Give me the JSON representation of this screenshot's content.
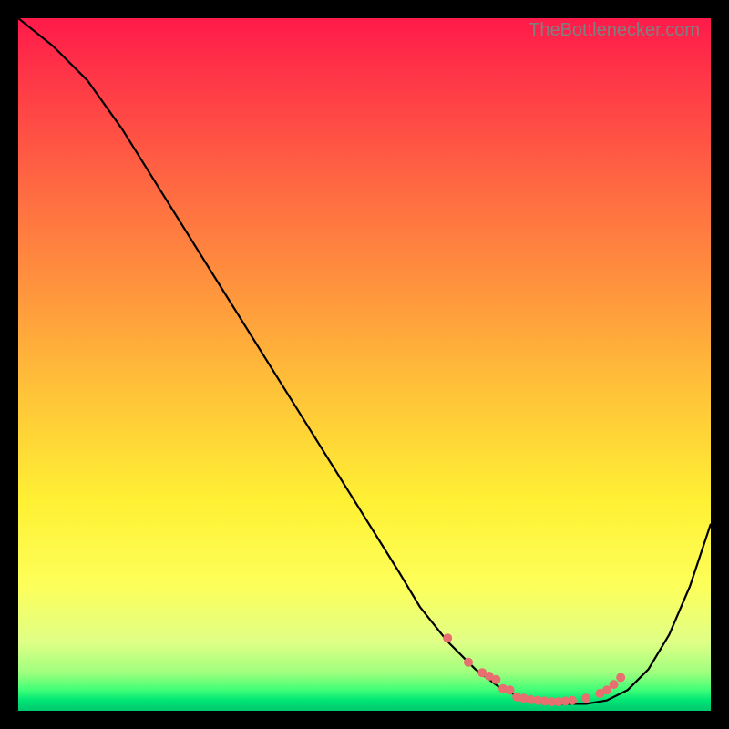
{
  "watermark": "TheBottlenecker.com",
  "chart_data": {
    "type": "line",
    "title": "",
    "xlabel": "",
    "ylabel": "",
    "xlim": [
      0,
      100
    ],
    "ylim": [
      0,
      100
    ],
    "series": [
      {
        "name": "curve",
        "color": "#000000",
        "x": [
          0,
          5,
          10,
          15,
          20,
          25,
          30,
          35,
          40,
          45,
          50,
          55,
          58,
          62,
          66,
          70,
          74,
          78,
          82,
          85,
          88,
          91,
          94,
          97,
          100
        ],
        "y": [
          100,
          96,
          91,
          84,
          76,
          68,
          60,
          52,
          44,
          36,
          28,
          20,
          15,
          10,
          6,
          3,
          1.5,
          1,
          1,
          1.5,
          3,
          6,
          11,
          18,
          27
        ]
      },
      {
        "name": "dots",
        "color": "#e76f6f",
        "style": "points",
        "x": [
          62,
          65,
          67,
          68,
          69,
          70,
          71,
          72,
          73,
          74,
          75,
          76,
          77,
          78,
          79,
          80,
          82,
          84,
          85,
          86,
          87
        ],
        "y": [
          10.5,
          7,
          5.5,
          5,
          4.5,
          3.2,
          3,
          2,
          1.8,
          1.6,
          1.5,
          1.4,
          1.3,
          1.3,
          1.4,
          1.5,
          1.8,
          2.5,
          3,
          3.8,
          4.8
        ]
      }
    ],
    "gradient": {
      "stops": [
        {
          "offset": 0.0,
          "color": "#ff1a4a"
        },
        {
          "offset": 0.1,
          "color": "#ff3b47"
        },
        {
          "offset": 0.25,
          "color": "#ff6b42"
        },
        {
          "offset": 0.4,
          "color": "#ff973d"
        },
        {
          "offset": 0.55,
          "color": "#ffc638"
        },
        {
          "offset": 0.7,
          "color": "#fff134"
        },
        {
          "offset": 0.82,
          "color": "#fdff5a"
        },
        {
          "offset": 0.9,
          "color": "#e0ff86"
        },
        {
          "offset": 0.945,
          "color": "#9fff7e"
        },
        {
          "offset": 0.97,
          "color": "#3fff77"
        },
        {
          "offset": 0.985,
          "color": "#00e676"
        },
        {
          "offset": 1.0,
          "color": "#00c86f"
        }
      ]
    }
  }
}
